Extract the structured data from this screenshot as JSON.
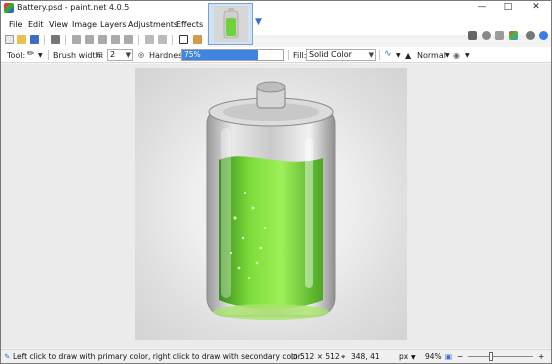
{
  "window": {
    "title": "Battery.psd - paint.net 4.0.5"
  },
  "menu": {
    "items": [
      "File",
      "Edit",
      "View",
      "Image",
      "Layers",
      "Adjustments",
      "Effects"
    ]
  },
  "options": {
    "tool_label": "Tool:",
    "brush_width_label": "Brush width:",
    "brush_width_value": "2",
    "hardness_label": "Hardness:",
    "hardness_value": "75%",
    "hardness_fraction": 0.75,
    "fill_label": "Fill:",
    "fill_value": "Solid Color",
    "blend_mode": "Normal"
  },
  "status": {
    "hint": "Left click to draw with primary color, right click to draw with secondary color.",
    "image_size": "512 × 512",
    "cursor_position": "348, 41",
    "units": "px",
    "zoom": "94%"
  },
  "colors": {
    "accent": "#3f85e0",
    "battery_green": "#7ddc3a"
  },
  "icons": {
    "title": "paintnet-app-icon",
    "toolbar": [
      "new-icon",
      "open-icon",
      "save-icon",
      "print-icon",
      "cut-icon",
      "copy-icon",
      "paste-icon",
      "crop-icon",
      "deselect-icon",
      "undo-icon",
      "redo-icon",
      "grid-icon",
      "ruler-icon"
    ],
    "system": [
      "tools-icon",
      "history-icon",
      "layers-icon",
      "colors-icon",
      "settings-icon",
      "help-icon"
    ]
  }
}
